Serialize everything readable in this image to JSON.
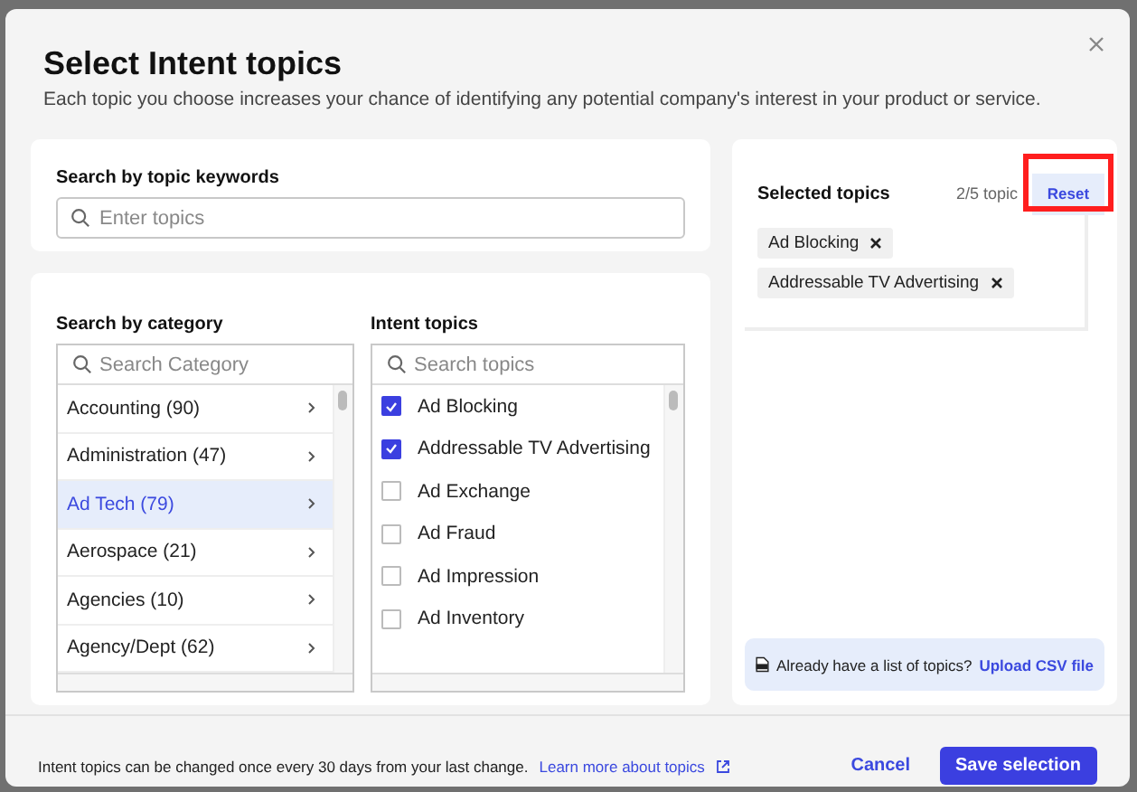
{
  "dialog": {
    "title": "Select Intent topics",
    "subtitle": "Each topic you choose increases your chance of identifying any potential company's interest in your product or service."
  },
  "keyword_search": {
    "label": "Search by topic keywords",
    "placeholder": "Enter topics"
  },
  "categories": {
    "label": "Search by category",
    "placeholder": "Search Category",
    "items": [
      {
        "label": "Accounting (90)",
        "selected": false
      },
      {
        "label": "Administration (47)",
        "selected": false
      },
      {
        "label": "Ad Tech (79)",
        "selected": true
      },
      {
        "label": "Aerospace (21)",
        "selected": false
      },
      {
        "label": "Agencies (10)",
        "selected": false
      },
      {
        "label": "Agency/Dept (62)",
        "selected": false
      }
    ]
  },
  "topics": {
    "label": "Intent topics",
    "placeholder": "Search topics",
    "items": [
      {
        "label": "Ad Blocking",
        "checked": true
      },
      {
        "label": "Addressable TV Advertising",
        "checked": true
      },
      {
        "label": "Ad Exchange",
        "checked": false
      },
      {
        "label": "Ad Fraud",
        "checked": false
      },
      {
        "label": "Ad Impression",
        "checked": false
      },
      {
        "label": "Ad Inventory",
        "checked": false
      }
    ]
  },
  "selected_panel": {
    "title": "Selected topics",
    "count": "2/5 topic",
    "reset": "Reset",
    "chips": [
      {
        "label": "Ad Blocking"
      },
      {
        "label": "Addressable TV Advertising"
      }
    ],
    "csv": {
      "text": "Already have a list of topics?",
      "link": "Upload CSV file"
    }
  },
  "footer": {
    "note": "Intent topics can be changed once every 30 days from your last change.",
    "link": "Learn more about topics"
  },
  "buttons": [
    {
      "label": "Cancel",
      "kind": "link"
    },
    {
      "label": "Save selection",
      "kind": "primary"
    }
  ]
}
